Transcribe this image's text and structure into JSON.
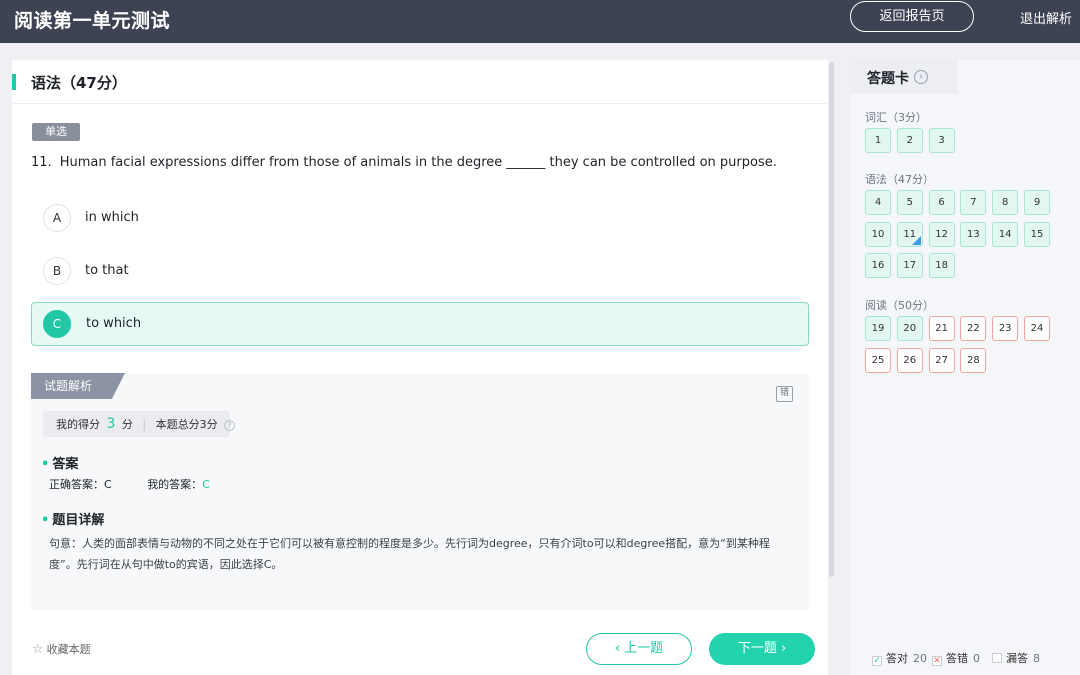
{
  "header": {
    "title": "阅读第一单元测试",
    "back_report": "返回报告页",
    "exit": "退出解析"
  },
  "section": {
    "title": "语法（47分）"
  },
  "question": {
    "type_tag": "单选",
    "number": "11.",
    "text": "Human facial expressions differ from those of animals in the degree ______ they can be controlled on purpose.",
    "options": [
      {
        "letter": "A",
        "text": "in which",
        "selected": false
      },
      {
        "letter": "B",
        "text": "to that",
        "selected": false
      },
      {
        "letter": "C",
        "text": "to which",
        "selected": true
      }
    ]
  },
  "analysis": {
    "tab_label": "试题解析",
    "my_score_label": "我的得分",
    "my_score_value": "3",
    "my_score_unit": "分",
    "total_score": "本题总分3分",
    "answer_heading": "答案",
    "correct_label": "正确答案：C",
    "my_answer_label": "我的答案：",
    "my_answer_value": "C",
    "detail_heading": "题目详解",
    "detail_text": "句意：人类的面部表情与动物的不同之处在于它们可以被有意控制的程度是多少。先行词为degree，只有介词to可以和degree搭配，意为“到某种程度”。先行词在从句中做to的宾语，因此选择C。"
  },
  "footer": {
    "favorite": "收藏本题",
    "prev": "上一题",
    "next": "下一题"
  },
  "answer_card": {
    "title": "答题卡",
    "groups": [
      {
        "label": "词汇（3分）",
        "items": [
          {
            "n": "1",
            "status": "correct"
          },
          {
            "n": "2",
            "status": "correct"
          },
          {
            "n": "3",
            "status": "correct"
          }
        ]
      },
      {
        "label": "语法（47分）",
        "items": [
          {
            "n": "4",
            "status": "correct"
          },
          {
            "n": "5",
            "status": "correct"
          },
          {
            "n": "6",
            "status": "correct"
          },
          {
            "n": "7",
            "status": "correct"
          },
          {
            "n": "8",
            "status": "correct"
          },
          {
            "n": "9",
            "status": "correct"
          },
          {
            "n": "10",
            "status": "correct"
          },
          {
            "n": "11",
            "status": "correct",
            "current": true
          },
          {
            "n": "12",
            "status": "correct"
          },
          {
            "n": "13",
            "status": "correct"
          },
          {
            "n": "14",
            "status": "correct"
          },
          {
            "n": "15",
            "status": "correct"
          },
          {
            "n": "16",
            "status": "correct"
          },
          {
            "n": "17",
            "status": "correct"
          },
          {
            "n": "18",
            "status": "correct"
          }
        ]
      },
      {
        "label": "阅读（50分）",
        "items": [
          {
            "n": "19",
            "status": "correct"
          },
          {
            "n": "20",
            "status": "correct"
          },
          {
            "n": "21",
            "status": "unanswered"
          },
          {
            "n": "22",
            "status": "unanswered"
          },
          {
            "n": "23",
            "status": "unanswered"
          },
          {
            "n": "24",
            "status": "unanswered"
          },
          {
            "n": "25",
            "status": "unanswered"
          },
          {
            "n": "26",
            "status": "unanswered"
          },
          {
            "n": "27",
            "status": "unanswered"
          },
          {
            "n": "28",
            "status": "unanswered"
          }
        ]
      }
    ],
    "legend": {
      "correct_label": "答对",
      "correct_count": "20",
      "wrong_label": "答错",
      "wrong_count": "0",
      "missed_label": "漏答",
      "missed_count": "8"
    }
  }
}
